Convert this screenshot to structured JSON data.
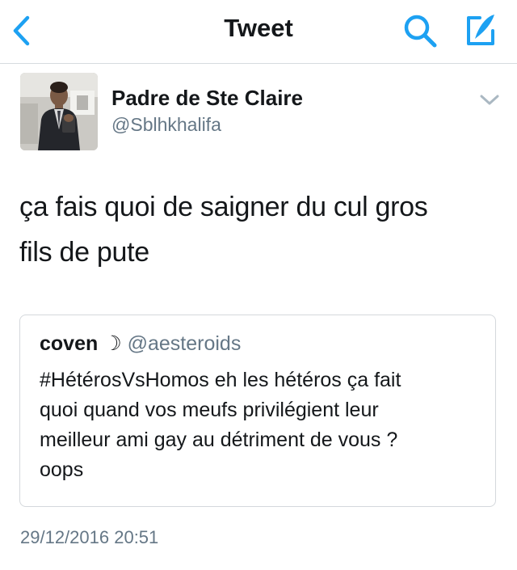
{
  "nav": {
    "title": "Tweet",
    "accent_color": "#1da1f2",
    "icons": [
      "chevron-left-icon",
      "search-icon",
      "compose-icon"
    ]
  },
  "tweet": {
    "author": {
      "display_name": "Padre de Ste Claire",
      "handle": "@Sblhkhalifa"
    },
    "text_line1": "ça fais quoi de saigner du cul gros",
    "text_line2": "fils de pute",
    "timestamp": "29/12/2016 20:51"
  },
  "quoted_tweet": {
    "display_name": "coven",
    "name_emoji": "☽",
    "handle": "@aesteroids",
    "text_line1": "#HétérosVsHomos eh les hétéros ça fait",
    "text_line2": "quoi quand vos meufs privilégient leur",
    "text_line3": "meilleur ami gay au détriment de vous ?",
    "text_line4": "oops"
  }
}
